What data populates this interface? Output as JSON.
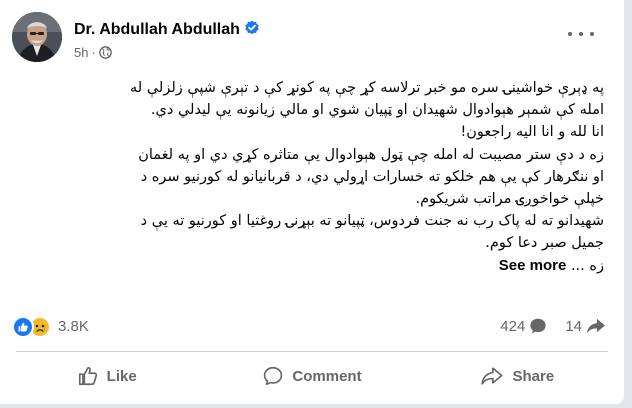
{
  "post": {
    "author": "Dr. Abdullah Abdullah",
    "timestamp": "5h",
    "separator": "·",
    "body_lines": [
      "په ډېرې خواشینۍ سره مو خبر ترلاسه کړ چې په کونړ کې د تېرې شپې زلزلې له",
      "امله کې شمېر هېوادوال شهیدان او ټپیان شوي او مالي زیانونه یې لیدلي دي.",
      "انا لله و انا الیه راجعون!",
      "زه د دې ستر مصیبت له امله چې ټول هېوادوال یې متاثره کړي دي او په لغمان",
      "او ننګرهار کې یې هم خلکو ته خسارات اړولي دي، د قربانیانو له کورنیو سره د",
      "خپلې خواخوږۍ مراتب شریکوم.",
      "شهیدانو ته له پاک رب نه جنت فردوس، ټپیانو ته بېړنۍ روغتیا او کورنیو ته یې د",
      "جمیل صبر دعا کوم."
    ],
    "last_line_prefix": "زه ...",
    "see_more_label": "See more"
  },
  "engagement": {
    "reactions_count": "3.8K",
    "comments_count": "424",
    "shares_count": "14",
    "reaction_icons": [
      "like-reaction",
      "sad-reaction"
    ]
  },
  "actions": {
    "like_label": "Like",
    "comment_label": "Comment",
    "share_label": "Share"
  },
  "colors": {
    "verified": "#1877f2",
    "like_blue": "#1877f2",
    "sad_yellow": "#f7b928",
    "muted_text": "#65676b"
  }
}
